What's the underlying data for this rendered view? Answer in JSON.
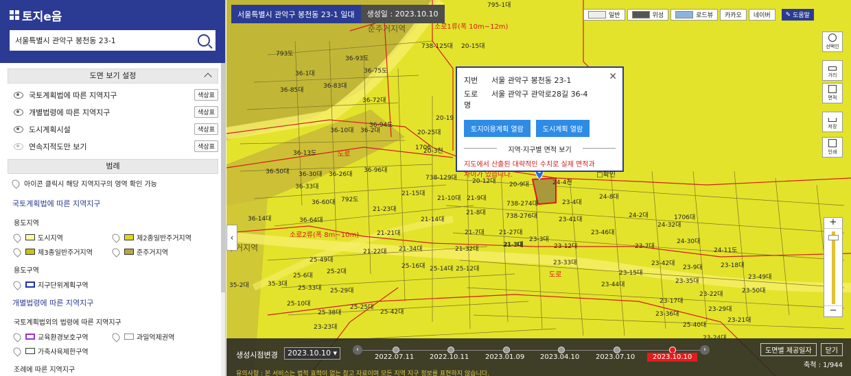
{
  "brand": {
    "logo_text": "토지e음"
  },
  "search": {
    "value": "서울특별시 관악구 봉천동 23-1"
  },
  "layers": {
    "title": "도면 보기 설정",
    "items": [
      {
        "label": "국토계획법에 따른 지역지구",
        "button": "색상표",
        "visible": true
      },
      {
        "label": "개별법령에 따른 지역지구",
        "button": "색상표",
        "visible": true
      },
      {
        "label": "도시계획시설",
        "button": "색상표",
        "visible": true
      },
      {
        "label": "연속지적도만 보기",
        "button": "색상표",
        "visible": false
      }
    ]
  },
  "legend": {
    "title": "범례",
    "hint": "아이콘 클릭시 해당 지역지구의 영역 확인 가능",
    "group1": "국토계획법에 따른 지역지구",
    "sub1": "용도지역",
    "zones": [
      {
        "label": "도시지역",
        "color": "#ffffa0"
      },
      {
        "label": "제2종일반주거지역",
        "color": "#e0d91a"
      },
      {
        "label": "제3종일반주거지역",
        "color": "#c9c21a"
      },
      {
        "label": "준주거지역",
        "color": "#b8a63e"
      }
    ],
    "sub2": "용도구역",
    "district": {
      "label": "지구단위계획구역",
      "color": "#1a2fb5"
    },
    "group2": "개별법령에 따른 지역지구",
    "sub3": "국토계획법외의 법령에 따른 지역지구",
    "zones2": [
      {
        "label": "교육환경보호구역",
        "color": "#9b2fc9"
      },
      {
        "label": "과밀억제권역",
        "color": "#888888"
      },
      {
        "label": "가축사육제한구역",
        "color": "#333333"
      }
    ],
    "sub4": "조례에 따른 지역지구"
  },
  "map": {
    "address_tag": "서울특별시 관악구 봉천동 23-1 일대",
    "created": "생성일 : 2023.10.10",
    "view_tabs": [
      {
        "label": "일반",
        "thumb": "map-thumb"
      },
      {
        "label": "위성",
        "thumb": "satellite-thumb"
      },
      {
        "label": "로드뷰",
        "thumb": "roadview-thumb"
      },
      {
        "label": "카카오"
      },
      {
        "label": "네이버"
      }
    ],
    "help": "도움말",
    "tools": [
      "선택인",
      "거리",
      "면적",
      "저장",
      "인쇄"
    ],
    "road_labels": [
      "소로1류(폭 10m~12m)",
      "소로2류(폭 8m~10m)",
      "도로",
      "도로"
    ],
    "district_label": "준주거지역",
    "zone_label": "주거지역",
    "parcels": [
      "795-1대",
      "793도",
      "36-93도",
      "36-75도",
      "36-1대",
      "36-83대",
      "36-85대",
      "36-72대",
      "738-125대",
      "20-15대",
      "36-94도",
      "36-10대",
      "36-2대",
      "20-25대",
      "20-19",
      "36-13도",
      "1706",
      "36-50대",
      "36-30대",
      "36-26대",
      "36-96대",
      "20-3천",
      "738-129대",
      "20-12대",
      "20-9대",
      "24-4천",
      "36-33대",
      "21-15대",
      "21-10대",
      "21-9대",
      "738-274대",
      "23-4대",
      "24-8대",
      "36-60대",
      "792도",
      "21-23대",
      "21-8대",
      "738-276대",
      "23-41대",
      "24-2대",
      "36-14대",
      "36-64대",
      "21-14대",
      "21-7대",
      "21-27대",
      "23-46대",
      "24-32대",
      "21-21대",
      "21-1대",
      "23-3대",
      "1706대",
      "21-22대",
      "21-34대",
      "21-32대",
      "21-3대",
      "23-12대",
      "23-7대",
      "24-30대",
      "25-49대",
      "25-6대",
      "25-16대",
      "25-14대",
      "25-12대",
      "23-33대",
      "23-42대",
      "23-9대",
      "24-11도",
      "25-2대",
      "25-29대",
      "23-15대",
      "23-18대",
      "35-2대",
      "35-3대",
      "25-33대",
      "23-44대",
      "23-35대",
      "23-49대",
      "25-10대",
      "25-25대",
      "23-17대",
      "23-22대",
      "23-50대",
      "25-38대",
      "25-42대",
      "23-36대",
      "23-29대",
      "25-40대",
      "23-23대",
      "23-21대",
      "23-24대"
    ],
    "popup": {
      "jibun_key": "지번",
      "jibun": "서울 관악구 봉천동 23-1",
      "road_key": "도로명",
      "road": "서울 관악구 관악로28길 36-4",
      "btn1": "토지이용계획 열람",
      "btn2": "도시계획 열람",
      "area_title": "지역·지구별 면적 보기",
      "warning": "지도에서 산출된 대략적인 수치로 실제 면적과 차이가 있습니다.",
      "confirm": "□확인"
    },
    "timeline": {
      "label": "생성시점변경",
      "selected": "2023.10.10 ▾",
      "dates": [
        "2022.07.11",
        "2022.10.11",
        "2023.01.09",
        "2023.04.10",
        "2023.07.10",
        "2023.10.10"
      ],
      "active_index": 5,
      "btn_dates": "도면별 제공일자",
      "btn_close": "닫기",
      "scale": "축척 : 1/944",
      "notice": "유의사항 : 본 서비스는 법적 효력이 없는 참고 자료이며 모든 지역 지구 정보를 표현하지 않습니다."
    }
  }
}
